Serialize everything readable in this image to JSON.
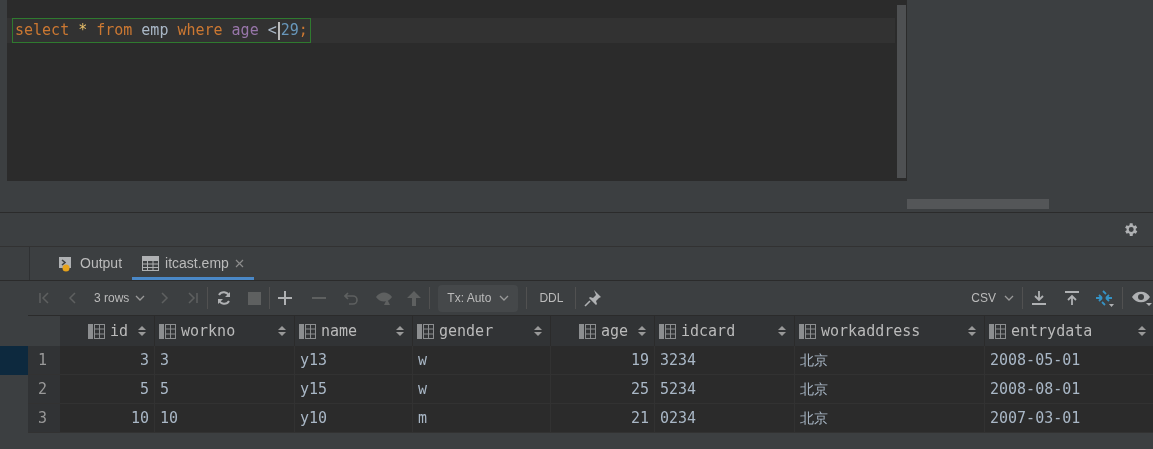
{
  "editor": {
    "words": [
      [
        {
          "text": "select",
          "kind": "keyword"
        }
      ],
      [
        {
          "text": "*",
          "kind": "star"
        }
      ],
      [
        {
          "text": "from",
          "kind": "keyword"
        }
      ],
      [
        {
          "text": "emp",
          "kind": "identifier"
        }
      ],
      [
        {
          "text": "where",
          "kind": "keyword"
        }
      ],
      [
        {
          "text": "age",
          "kind": "column"
        }
      ],
      [
        {
          "text": "<",
          "kind": "operator"
        },
        {
          "text": "29",
          "kind": "number"
        },
        {
          "text": ";",
          "kind": "keyword"
        }
      ]
    ]
  },
  "tabs": [
    {
      "label": "Output",
      "selected": false
    },
    {
      "label": "itcast.emp",
      "selected": true
    }
  ],
  "toolbar": {
    "rows": "3 rows",
    "tx": "Tx: Auto",
    "ddl": "DDL",
    "format": "CSV"
  },
  "table": {
    "columns": [
      {
        "label": "id"
      },
      {
        "label": "workno"
      },
      {
        "label": "name"
      },
      {
        "label": "gender"
      },
      {
        "label": "age"
      },
      {
        "label": "idcard"
      },
      {
        "label": "workaddress"
      },
      {
        "label": "entrydata"
      }
    ],
    "rows": [
      {
        "number": "1",
        "selected": true,
        "cells": [
          "3",
          "3",
          "y13",
          "w",
          "19",
          "3234",
          "北京",
          "2008-05-01"
        ]
      },
      {
        "number": "2",
        "selected": false,
        "cells": [
          "5",
          "5",
          "y15",
          "w",
          "25",
          "5234",
          "北京",
          "2008-08-01"
        ]
      },
      {
        "number": "3",
        "selected": false,
        "cells": [
          "10",
          "10",
          "y10",
          "m",
          "21",
          "0234",
          "北京",
          "2007-03-01"
        ]
      }
    ]
  }
}
